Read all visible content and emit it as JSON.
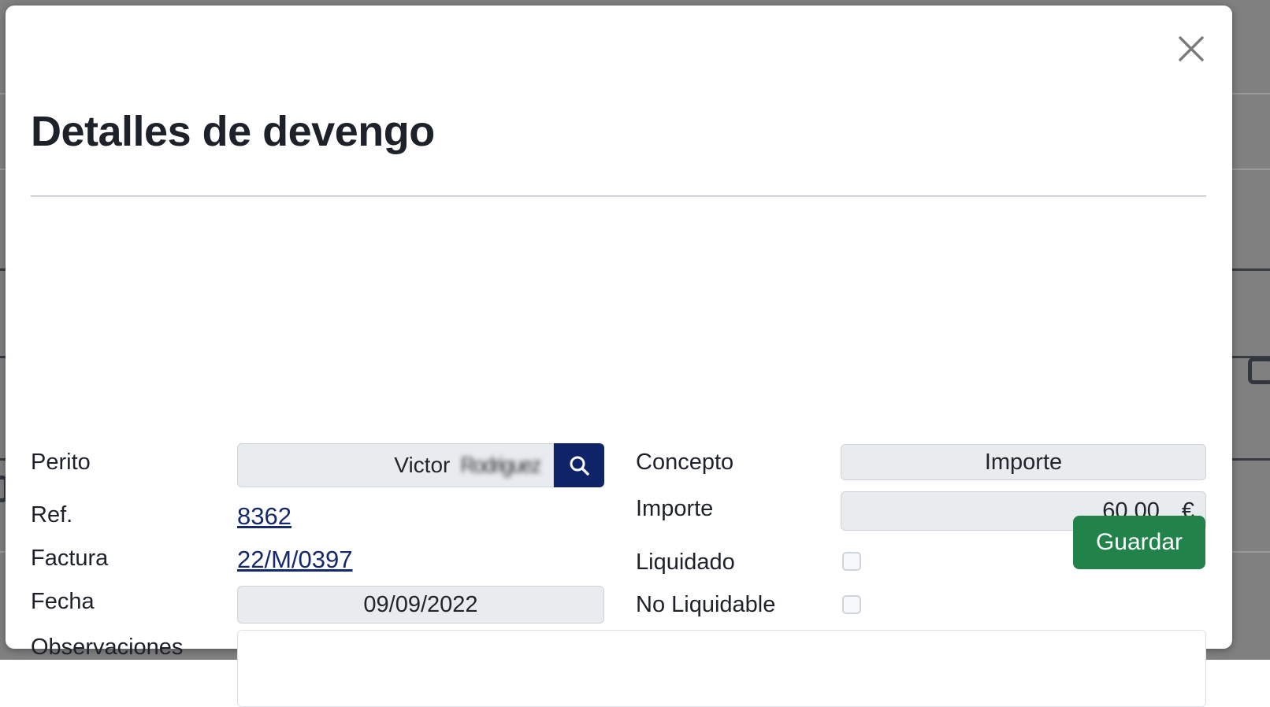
{
  "modal": {
    "title": "Detalles de devengo",
    "close_icon": "close-icon"
  },
  "form": {
    "perito": {
      "label": "Perito",
      "value_visible": "Victor",
      "value_redacted": "Rodriguez",
      "search_icon": "search-icon"
    },
    "ref": {
      "label": "Ref.",
      "value": "8362"
    },
    "factura": {
      "label": "Factura",
      "value": "22/M/0397"
    },
    "fecha": {
      "label": "Fecha",
      "value": "09/09/2022"
    },
    "observaciones": {
      "label": "Observaciones",
      "value": "",
      "placeholder": ""
    },
    "concepto": {
      "label": "Concepto",
      "value": "Importe"
    },
    "importe": {
      "label": "Importe",
      "value": "60,00",
      "currency": "€"
    },
    "liquidado": {
      "label": "Liquidado",
      "checked": false
    },
    "no_liquidable": {
      "label": "No Liquidable",
      "checked": false
    }
  },
  "actions": {
    "save_label": "Guardar"
  },
  "colors": {
    "accent_navy": "#0f2468",
    "link_navy": "#14296b",
    "save_green": "#21824a",
    "field_bg": "#e9ecef",
    "field_border": "#ced4da",
    "overlay": "#808080"
  }
}
